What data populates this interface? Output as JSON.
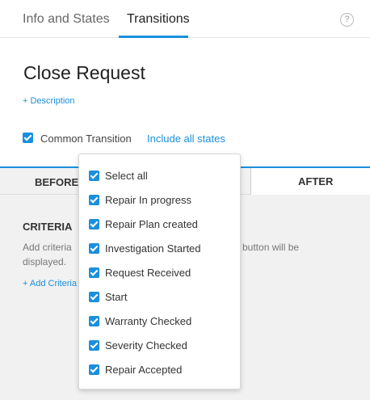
{
  "tabs": [
    {
      "label": "Info and States",
      "active": false
    },
    {
      "label": "Transitions",
      "active": true
    }
  ],
  "help_icon": {
    "glyph": "?",
    "icon": "question-circle-icon"
  },
  "title": "Close Request",
  "description_link": "+ Description",
  "common_transition": {
    "checked": true,
    "label": "Common Transition",
    "include_link": "Include all states"
  },
  "before_after": {
    "before_label": "BEFORE",
    "after_label": "AFTER"
  },
  "criteria": {
    "title": "CRITERIA",
    "desc_part1": "Add criteria",
    "desc_part2": "button will be",
    "desc_part3": "displayed.",
    "add_link": "+ Add Criteria"
  },
  "dropdown": {
    "items": [
      {
        "label": "Select all",
        "checked": true
      },
      {
        "label": "Repair In progress",
        "checked": true
      },
      {
        "label": "Repair Plan created",
        "checked": true
      },
      {
        "label": "Investigation Started",
        "checked": true
      },
      {
        "label": "Request Received",
        "checked": true
      },
      {
        "label": "Start",
        "checked": true
      },
      {
        "label": "Warranty Checked",
        "checked": true
      },
      {
        "label": "Severity Checked",
        "checked": true
      },
      {
        "label": "Repair Accepted",
        "checked": true
      }
    ]
  },
  "colors": {
    "accent": "#1a8fdc",
    "panel_bg": "#f1f1f1"
  }
}
